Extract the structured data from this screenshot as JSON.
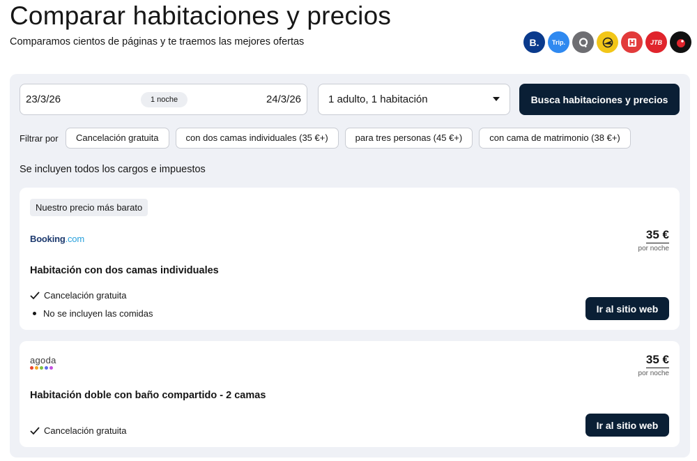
{
  "header": {
    "title": "Comparar habitaciones y precios",
    "subtitle": "Comparamos cientos de páginas y te traemos las mejores ofertas"
  },
  "providers": [
    {
      "name": "booking-icon",
      "label": "B.",
      "color": "#0a3a8c"
    },
    {
      "name": "trip-icon",
      "label": "Trip.",
      "color": "#2f89f0"
    },
    {
      "name": "search-provider-icon",
      "label": "",
      "color": "#6e6e72"
    },
    {
      "name": "plane-provider-icon",
      "label": "",
      "color": "#f2c618"
    },
    {
      "name": "h-provider-icon",
      "label": "",
      "color": "#e23b3b"
    },
    {
      "name": "jtb-provider-icon",
      "label": "JTB",
      "color": "#e0242c"
    },
    {
      "name": "dot-provider-icon",
      "label": "",
      "color": "#111111"
    }
  ],
  "search": {
    "checkin": "23/3/26",
    "nights": "1 noche",
    "checkout": "24/3/26",
    "guests": "1 adulto, 1 habitación",
    "button": "Busca habitaciones y precios"
  },
  "filters": {
    "label": "Filtrar por",
    "chips": [
      "Cancelación gratuita",
      "con dos camas individuales (35 €+)",
      "para tres personas (45 €+)",
      "con cama de matrimonio (38 €+)"
    ]
  },
  "taxes_note": "Se incluyen todos los cargos e impuestos",
  "offers": [
    {
      "badge": "Nuestro precio más barato",
      "provider_main": "Booking",
      "provider_suffix": ".com",
      "price": "35 €",
      "per": "por noche",
      "room": "Habitación con dos camas individuales",
      "features": [
        "Cancelación gratuita",
        "No se incluyen las comidas"
      ],
      "button": "Ir al sitio web"
    },
    {
      "provider": "agoda",
      "price": "35 €",
      "per": "por noche",
      "room": "Habitación doble con baño compartido - 2 camas",
      "features": [
        "Cancelación gratuita"
      ],
      "button": "Ir al sitio web"
    }
  ],
  "colors": {
    "primary_button": "#0a1f35",
    "panel_bg": "#eff1f6",
    "agoda_dots": [
      "#e8452e",
      "#f5a623",
      "#7cc242",
      "#5a6ee6",
      "#c34fe0"
    ]
  }
}
